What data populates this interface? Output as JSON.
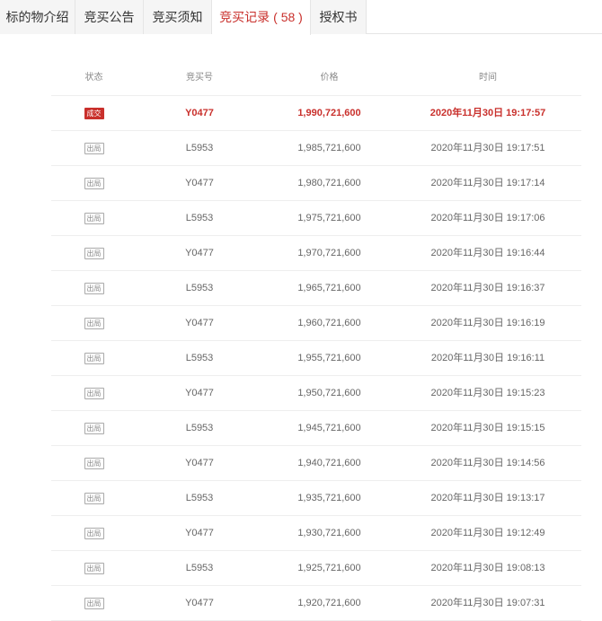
{
  "tabs": [
    {
      "label": "标的物介绍"
    },
    {
      "label": "竞买公告"
    },
    {
      "label": "竞买须知"
    },
    {
      "label": "竞买记录",
      "count": "( 58 )",
      "active": true
    },
    {
      "label": "授权书"
    }
  ],
  "table": {
    "headers": {
      "status": "状态",
      "bid_no": "竞买号",
      "price": "价格",
      "time": "时间"
    },
    "rows": [
      {
        "status": "成交",
        "bid_no": "Y0477",
        "price": "1,990,721,600",
        "time": "2020年11月30日 19:17:57"
      },
      {
        "status": "出局",
        "bid_no": "L5953",
        "price": "1,985,721,600",
        "time": "2020年11月30日 19:17:51"
      },
      {
        "status": "出局",
        "bid_no": "Y0477",
        "price": "1,980,721,600",
        "time": "2020年11月30日 19:17:14"
      },
      {
        "status": "出局",
        "bid_no": "L5953",
        "price": "1,975,721,600",
        "time": "2020年11月30日 19:17:06"
      },
      {
        "status": "出局",
        "bid_no": "Y0477",
        "price": "1,970,721,600",
        "time": "2020年11月30日 19:16:44"
      },
      {
        "status": "出局",
        "bid_no": "L5953",
        "price": "1,965,721,600",
        "time": "2020年11月30日 19:16:37"
      },
      {
        "status": "出局",
        "bid_no": "Y0477",
        "price": "1,960,721,600",
        "time": "2020年11月30日 19:16:19"
      },
      {
        "status": "出局",
        "bid_no": "L5953",
        "price": "1,955,721,600",
        "time": "2020年11月30日 19:16:11"
      },
      {
        "status": "出局",
        "bid_no": "Y0477",
        "price": "1,950,721,600",
        "time": "2020年11月30日 19:15:23"
      },
      {
        "status": "出局",
        "bid_no": "L5953",
        "price": "1,945,721,600",
        "time": "2020年11月30日 19:15:15"
      },
      {
        "status": "出局",
        "bid_no": "Y0477",
        "price": "1,940,721,600",
        "time": "2020年11月30日 19:14:56"
      },
      {
        "status": "出局",
        "bid_no": "L5953",
        "price": "1,935,721,600",
        "time": "2020年11月30日 19:13:17"
      },
      {
        "status": "出局",
        "bid_no": "Y0477",
        "price": "1,930,721,600",
        "time": "2020年11月30日 19:12:49"
      },
      {
        "status": "出局",
        "bid_no": "L5953",
        "price": "1,925,721,600",
        "time": "2020年11月30日 19:08:13"
      },
      {
        "status": "出局",
        "bid_no": "Y0477",
        "price": "1,920,721,600",
        "time": "2020年11月30日 19:07:31"
      }
    ]
  },
  "colors": {
    "accent": "#c9302c",
    "border": "#e5e5e5",
    "text": "#666666"
  }
}
